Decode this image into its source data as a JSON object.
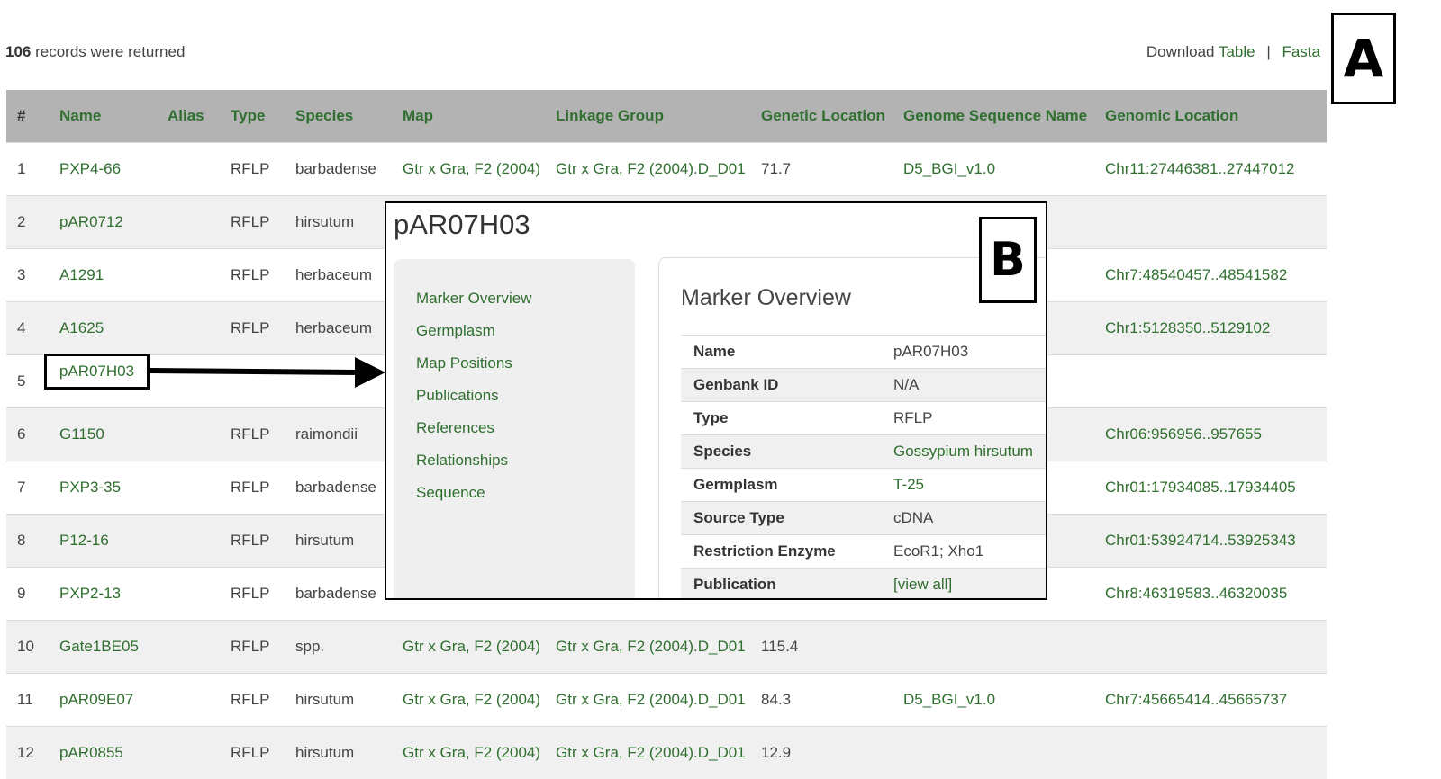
{
  "results": {
    "count": "106",
    "count_suffix": "records were returned",
    "download_label": "Download",
    "download_table": "Table",
    "separator": "|",
    "download_fasta": "Fasta"
  },
  "panel_labels": {
    "a": "A",
    "b": "B"
  },
  "table": {
    "headers": {
      "num": "#",
      "name": "Name",
      "alias": "Alias",
      "type": "Type",
      "species": "Species",
      "map": "Map",
      "linkage_group": "Linkage Group",
      "genetic_location": "Genetic Location",
      "genome_sequence_name": "Genome Sequence Name",
      "genomic_location": "Genomic Location"
    },
    "rows": [
      {
        "num": "1",
        "name": "PXP4-66",
        "alias": "",
        "type": "RFLP",
        "species": "barbadense",
        "map": "Gtr x Gra, F2 (2004)",
        "lg": "Gtr x Gra, F2 (2004).D_D01",
        "gl": "71.7",
        "gsn": "D5_BGI_v1.0",
        "gloc": "Chr11:27446381..27447012"
      },
      {
        "num": "2",
        "name": "pAR0712",
        "alias": "",
        "type": "RFLP",
        "species": "hirsutum",
        "map": "",
        "lg": "",
        "gl": "",
        "gsn": "",
        "gloc": ""
      },
      {
        "num": "3",
        "name": "A1291",
        "alias": "",
        "type": "RFLP",
        "species": "herbaceum",
        "map": "",
        "lg": "",
        "gl": "",
        "gsn": "",
        "gloc": "Chr7:48540457..48541582"
      },
      {
        "num": "4",
        "name": "A1625",
        "alias": "",
        "type": "RFLP",
        "species": "herbaceum",
        "map": "",
        "lg": "",
        "gl": "",
        "gsn": "",
        "gloc": "Chr1:5128350..5129102"
      },
      {
        "num": "5",
        "name": "pAR07H03",
        "alias": "",
        "type": "",
        "species": "",
        "map": "",
        "lg": "",
        "gl": "",
        "gsn": "",
        "gloc": ""
      },
      {
        "num": "6",
        "name": "G1150",
        "alias": "",
        "type": "RFLP",
        "species": "raimondii",
        "map": "",
        "lg": "",
        "gl": "",
        "gsn": "",
        "gloc": "Chr06:956956..957655"
      },
      {
        "num": "7",
        "name": "PXP3-35",
        "alias": "",
        "type": "RFLP",
        "species": "barbadense",
        "map": "",
        "lg": "",
        "gl": "",
        "gsn": "",
        "gloc": "Chr01:17934085..17934405"
      },
      {
        "num": "8",
        "name": "P12-16",
        "alias": "",
        "type": "RFLP",
        "species": "hirsutum",
        "map": "",
        "lg": "",
        "gl": "",
        "gsn": "",
        "gloc": "Chr01:53924714..53925343"
      },
      {
        "num": "9",
        "name": "PXP2-13",
        "alias": "",
        "type": "RFLP",
        "species": "barbadense",
        "map": "",
        "lg": "",
        "gl": "",
        "gsn": "",
        "gloc": "Chr8:46319583..46320035"
      },
      {
        "num": "10",
        "name": "Gate1BE05",
        "alias": "",
        "type": "RFLP",
        "species": "spp.",
        "map": "Gtr x Gra, F2 (2004)",
        "lg": "Gtr x Gra, F2 (2004).D_D01",
        "gl": "115.4",
        "gsn": "",
        "gloc": ""
      },
      {
        "num": "11",
        "name": "pAR09E07",
        "alias": "",
        "type": "RFLP",
        "species": "hirsutum",
        "map": "Gtr x Gra, F2 (2004)",
        "lg": "Gtr x Gra, F2 (2004).D_D01",
        "gl": "84.3",
        "gsn": "D5_BGI_v1.0",
        "gloc": "Chr7:45665414..45665737"
      },
      {
        "num": "12",
        "name": "pAR0855",
        "alias": "",
        "type": "RFLP",
        "species": "hirsutum",
        "map": "Gtr x Gra, F2 (2004)",
        "lg": "Gtr x Gra, F2 (2004).D_D01",
        "gl": "12.9",
        "gsn": "",
        "gloc": ""
      }
    ]
  },
  "popup": {
    "title": "pAR07H03",
    "nav": [
      "Marker Overview",
      "Germplasm",
      "Map Positions",
      "Publications",
      "References",
      "Relationships",
      "Sequence"
    ],
    "detail_title": "Marker Overview",
    "fields": [
      {
        "key": "Name",
        "value": "pAR07H03",
        "link": false
      },
      {
        "key": "Genbank ID",
        "value": "N/A",
        "link": false
      },
      {
        "key": "Type",
        "value": "RFLP",
        "link": false
      },
      {
        "key": "Species",
        "value": "Gossypium hirsutum",
        "link": true
      },
      {
        "key": "Germplasm",
        "value": "T-25",
        "link": true
      },
      {
        "key": "Source Type",
        "value": "cDNA",
        "link": false
      },
      {
        "key": "Restriction Enzyme",
        "value": "EcoR1; Xho1",
        "link": false
      },
      {
        "key": "Publication",
        "value": "[view all]",
        "link": true
      }
    ]
  },
  "colors": {
    "link_green": "#2f6f2f",
    "header_gray": "#b3b3b3",
    "stripe_gray": "#f0f0f0"
  }
}
